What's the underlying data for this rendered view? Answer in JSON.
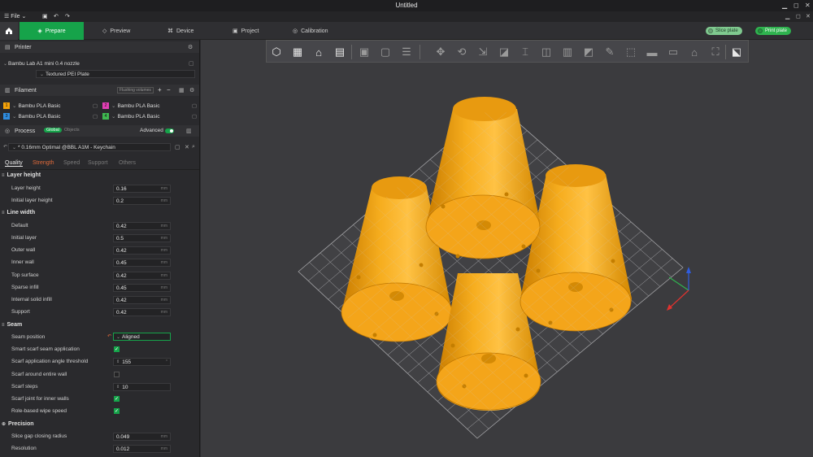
{
  "window": {
    "title": "Untitled",
    "min": "▁",
    "max": "◻",
    "close": "✕"
  },
  "menubar": {
    "file_label": "File",
    "menu_icon": "hamburger-icon",
    "file_arrow": "⌄"
  },
  "tabs": [
    {
      "label": "Prepare",
      "icon": "prepare-icon",
      "glyph": "◈"
    },
    {
      "label": "Preview",
      "icon": "preview-icon",
      "glyph": "◇"
    },
    {
      "label": "Device",
      "icon": "device-icon",
      "glyph": "⌘"
    },
    {
      "label": "Project",
      "icon": "project-icon",
      "glyph": "▣"
    },
    {
      "label": "Calibration",
      "icon": "calibration-icon",
      "glyph": "◎"
    }
  ],
  "actions": {
    "slice_label": "Slice plate",
    "print_label": "Print plate"
  },
  "printer": {
    "header": "Printer",
    "name": "Bambu Lab A1 mini 0.4 nozzle",
    "plate": "Textured PEI Plate"
  },
  "filament": {
    "header": "Filament",
    "flushing": "Flushing volumes",
    "items": [
      {
        "num": "1",
        "name": "Bambu PLA Basic",
        "color": "#f5a30a"
      },
      {
        "num": "2",
        "name": "Bambu PLA Basic",
        "color": "#e23fb5"
      },
      {
        "num": "3",
        "name": "Bambu PLA Basic",
        "color": "#2f8de0"
      },
      {
        "num": "4",
        "name": "Bambu PLA Basic",
        "color": "#3fb950"
      }
    ]
  },
  "process": {
    "header": "Process",
    "global_label": "Global",
    "objects_label": "Objects",
    "advanced_label": "Advanced",
    "advanced_on": true,
    "profile": "* 0.16mm Optimal @BBL A1M - Keychain"
  },
  "subtabs": [
    "Quality",
    "Strength",
    "Speed",
    "Support",
    "Others"
  ],
  "sections": {
    "layer_height": {
      "title": "Layer height",
      "params": [
        {
          "label": "Layer height",
          "value": "0.16",
          "unit": "mm"
        },
        {
          "label": "Initial layer height",
          "value": "0.2",
          "unit": "mm"
        }
      ]
    },
    "line_width": {
      "title": "Line width",
      "params": [
        {
          "label": "Default",
          "value": "0.42",
          "unit": "mm"
        },
        {
          "label": "Initial layer",
          "value": "0.5",
          "unit": "mm"
        },
        {
          "label": "Outer wall",
          "value": "0.42",
          "unit": "mm"
        },
        {
          "label": "Inner wall",
          "value": "0.45",
          "unit": "mm"
        },
        {
          "label": "Top surface",
          "value": "0.42",
          "unit": "mm"
        },
        {
          "label": "Sparse infill",
          "value": "0.45",
          "unit": "mm"
        },
        {
          "label": "Internal solid infill",
          "value": "0.42",
          "unit": "mm"
        },
        {
          "label": "Support",
          "value": "0.42",
          "unit": "mm"
        }
      ]
    },
    "seam": {
      "title": "Seam",
      "seam_position_label": "Seam position",
      "seam_position_value": "Aligned",
      "smart_scarf_label": "Smart scarf seam application",
      "smart_scarf": true,
      "scarf_angle_label": "Scarf application angle threshold",
      "scarf_angle_value": "155",
      "scarf_around_label": "Scarf around entire wall",
      "scarf_around": false,
      "scarf_steps_label": "Scarf steps",
      "scarf_steps_value": "10",
      "scarf_inner_label": "Scarf joint for inner walls",
      "scarf_inner": true,
      "role_wipe_label": "Role-based wipe speed",
      "role_wipe": true
    },
    "precision": {
      "title": "Precision",
      "params": [
        {
          "label": "Slice gap closing radius",
          "value": "0.049",
          "unit": "mm"
        },
        {
          "label": "Resolution",
          "value": "0.012",
          "unit": "mm"
        }
      ]
    }
  },
  "object_color": "#f5a30a",
  "accent": "#16a34a"
}
